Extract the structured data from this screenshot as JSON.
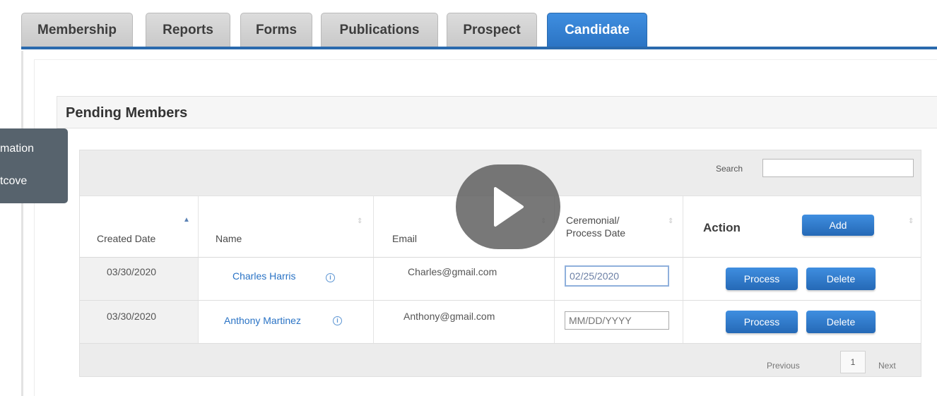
{
  "tabs": [
    {
      "label": "Membership",
      "active": false
    },
    {
      "label": "Reports",
      "active": false
    },
    {
      "label": "Forms",
      "active": false
    },
    {
      "label": "Publications",
      "active": false
    },
    {
      "label": "Prospect",
      "active": false
    },
    {
      "label": "Candidate",
      "active": true
    }
  ],
  "section": {
    "title": "Pending Members"
  },
  "search": {
    "label": "Search",
    "value": ""
  },
  "table": {
    "headers": {
      "created": "Created Date",
      "name": "Name",
      "email": "Email",
      "date_line1": "Ceremonial/",
      "date_line2": "Process Date",
      "action": "Action"
    },
    "add_label": "Add",
    "rows": [
      {
        "created": "03/30/2020",
        "name": "Charles Harris",
        "email": "Charles@gmail.com",
        "date_value": "02/25/2020",
        "date_placeholder": "MM/DD/YYYY"
      },
      {
        "created": "03/30/2020",
        "name": "Anthony Martinez",
        "email": "Anthony@gmail.com",
        "date_value": "",
        "date_placeholder": "MM/DD/YYYY"
      }
    ],
    "process_label": "Process",
    "delete_label": "Delete"
  },
  "pagination": {
    "previous": "Previous",
    "page": "1",
    "next": "Next"
  },
  "side_tooltip": {
    "line1": "mation",
    "line2": "tcove"
  },
  "colors": {
    "accent": "#2a6aad",
    "button": "#2b74c4",
    "link": "#2a73c5"
  },
  "icons": {
    "play": "play-icon",
    "info": "info-icon",
    "sort": "sort-icon"
  }
}
